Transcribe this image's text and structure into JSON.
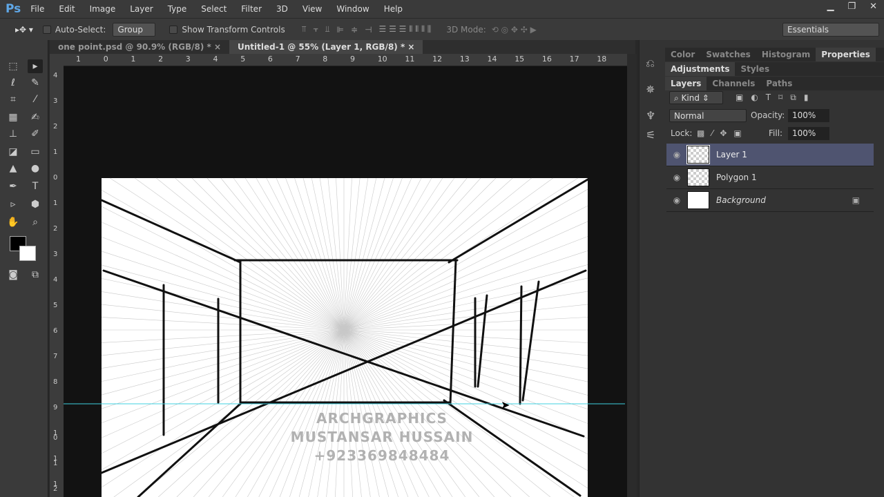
{
  "menubar": {
    "logo": "Ps",
    "items": [
      "File",
      "Edit",
      "Image",
      "Layer",
      "Type",
      "Select",
      "Filter",
      "3D",
      "View",
      "Window",
      "Help"
    ]
  },
  "options": {
    "auto_select_label": "Auto-Select:",
    "auto_select_value": "Group",
    "show_transform_label": "Show Transform Controls",
    "mode_label": "3D Mode:",
    "workspace": "Essentials"
  },
  "tabs": [
    {
      "label": "one point.psd @ 90.9% (RGB/8) *",
      "close": "×"
    },
    {
      "label": "Untitled-1 @ 55% (Layer 1, RGB/8) *",
      "close": "×"
    }
  ],
  "hruler": [
    "1",
    "0",
    "1",
    "2",
    "3",
    "4",
    "5",
    "6",
    "7",
    "8",
    "9",
    "10",
    "11",
    "12",
    "13",
    "14",
    "15",
    "16",
    "17",
    "18"
  ],
  "vruler": [
    "4",
    "3",
    "2",
    "1",
    "0",
    "1",
    "2",
    "3",
    "4",
    "5",
    "6",
    "7",
    "8",
    "9",
    "1 0",
    "1 1",
    "1 2"
  ],
  "canvas": {
    "watermark": [
      "ARCHGRAPHICS",
      "MUSTANSAR HUSSAIN",
      "+923369848484"
    ]
  },
  "panels": {
    "row1": [
      "Color",
      "Swatches",
      "Histogram",
      "Properties"
    ],
    "row2": [
      "Adjustments",
      "Styles"
    ],
    "row3": [
      "Layers",
      "Channels",
      "Paths"
    ],
    "kind": "Kind",
    "blend": "Normal",
    "opacity_label": "Opacity:",
    "opacity": "100%",
    "lock_label": "Lock:",
    "fill_label": "Fill:",
    "fill": "100%"
  },
  "layers": [
    {
      "name": "Layer 1",
      "selected": true
    },
    {
      "name": "Polygon 1",
      "selected": false
    },
    {
      "name": "Background",
      "selected": false,
      "locked": true
    }
  ],
  "colors": {
    "selected_layer": "#4f5470",
    "guide": "#3fd0e0"
  }
}
